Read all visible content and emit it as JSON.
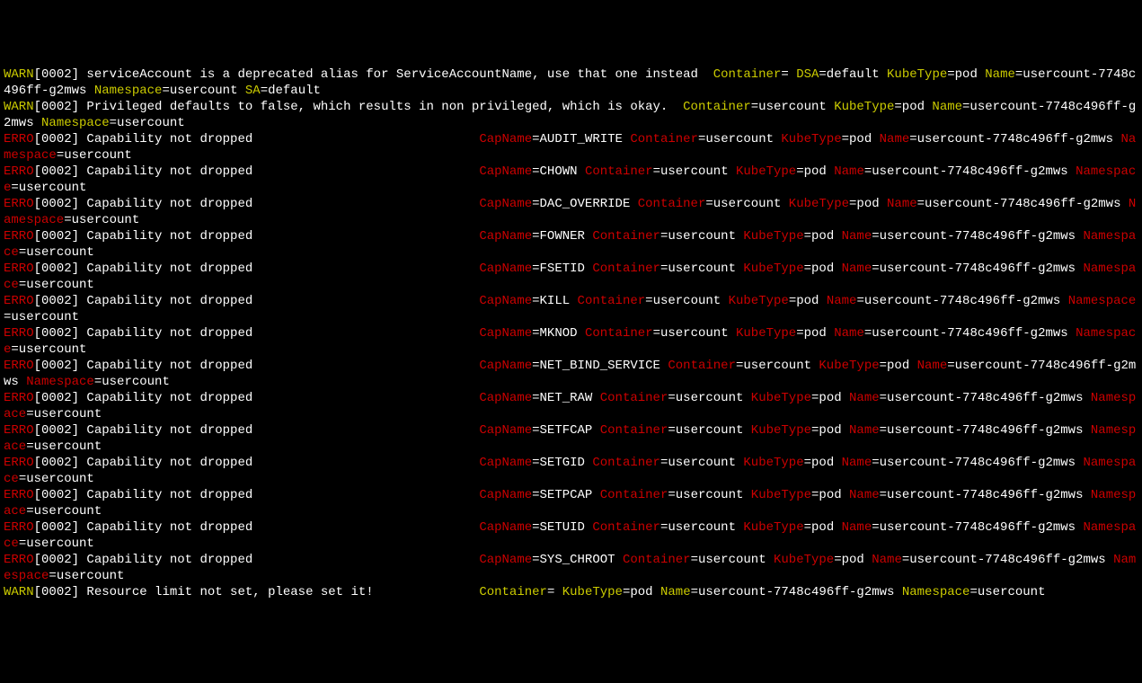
{
  "labels": {
    "WARN": "WARN",
    "ERRO": "ERRO",
    "Container": "Container",
    "DSA": "DSA",
    "KubeType": "KubeType",
    "Name": "Name",
    "Namespace": "Namespace",
    "SA": "SA",
    "CapName": "CapName"
  },
  "lines": [
    {
      "level": "WARN",
      "ts": "[0002]",
      "msg": " serviceAccount is a deprecated alias for ServiceAccountName, use that one instead  ",
      "kv": [
        {
          "k": "Container",
          "v": ""
        },
        {
          "k": "DSA",
          "v": "default"
        },
        {
          "k": "KubeType",
          "v": "pod"
        },
        {
          "k": "Name",
          "v": "usercount-7748c496ff-g2mws"
        },
        {
          "k": "Namespace",
          "v": "usercount"
        },
        {
          "k": "SA",
          "v": "default"
        }
      ]
    },
    {
      "level": "WARN",
      "ts": "[0002]",
      "msg": " Privileged defaults to false, which results in non privileged, which is okay.  ",
      "kv": [
        {
          "k": "Container",
          "v": "usercount"
        },
        {
          "k": "KubeType",
          "v": "pod"
        },
        {
          "k": "Name",
          "v": "usercount-7748c496ff-g2mws"
        },
        {
          "k": "Namespace",
          "v": "usercount"
        }
      ]
    },
    {
      "level": "ERRO",
      "ts": "[0002]",
      "msg": " Capability not dropped",
      "pad": 63,
      "kv": [
        {
          "k": "CapName",
          "v": "AUDIT_WRITE"
        },
        {
          "k": "Container",
          "v": "usercount"
        },
        {
          "k": "KubeType",
          "v": "pod"
        },
        {
          "k": "Name",
          "v": "usercount-7748c496ff-g2mws"
        },
        {
          "k": "Namespace",
          "v": "usercount"
        }
      ]
    },
    {
      "level": "ERRO",
      "ts": "[0002]",
      "msg": " Capability not dropped",
      "pad": 63,
      "kv": [
        {
          "k": "CapName",
          "v": "CHOWN"
        },
        {
          "k": "Container",
          "v": "usercount"
        },
        {
          "k": "KubeType",
          "v": "pod"
        },
        {
          "k": "Name",
          "v": "usercount-7748c496ff-g2mws"
        },
        {
          "k": "Namespace",
          "v": "usercount"
        }
      ]
    },
    {
      "level": "ERRO",
      "ts": "[0002]",
      "msg": " Capability not dropped",
      "pad": 63,
      "kv": [
        {
          "k": "CapName",
          "v": "DAC_OVERRIDE"
        },
        {
          "k": "Container",
          "v": "usercount"
        },
        {
          "k": "KubeType",
          "v": "pod"
        },
        {
          "k": "Name",
          "v": "usercount-7748c496ff-g2mws"
        },
        {
          "k": "Namespace",
          "v": "usercount"
        }
      ]
    },
    {
      "level": "ERRO",
      "ts": "[0002]",
      "msg": " Capability not dropped",
      "pad": 63,
      "kv": [
        {
          "k": "CapName",
          "v": "FOWNER"
        },
        {
          "k": "Container",
          "v": "usercount"
        },
        {
          "k": "KubeType",
          "v": "pod"
        },
        {
          "k": "Name",
          "v": "usercount-7748c496ff-g2mws"
        },
        {
          "k": "Namespace",
          "v": "usercount"
        }
      ]
    },
    {
      "level": "ERRO",
      "ts": "[0002]",
      "msg": " Capability not dropped",
      "pad": 63,
      "kv": [
        {
          "k": "CapName",
          "v": "FSETID"
        },
        {
          "k": "Container",
          "v": "usercount"
        },
        {
          "k": "KubeType",
          "v": "pod"
        },
        {
          "k": "Name",
          "v": "usercount-7748c496ff-g2mws"
        },
        {
          "k": "Namespace",
          "v": "usercount"
        }
      ]
    },
    {
      "level": "ERRO",
      "ts": "[0002]",
      "msg": " Capability not dropped",
      "pad": 63,
      "kv": [
        {
          "k": "CapName",
          "v": "KILL"
        },
        {
          "k": "Container",
          "v": "usercount"
        },
        {
          "k": "KubeType",
          "v": "pod"
        },
        {
          "k": "Name",
          "v": "usercount-7748c496ff-g2mws"
        },
        {
          "k": "Namespace",
          "v": "usercount"
        }
      ]
    },
    {
      "level": "ERRO",
      "ts": "[0002]",
      "msg": " Capability not dropped",
      "pad": 63,
      "kv": [
        {
          "k": "CapName",
          "v": "MKNOD"
        },
        {
          "k": "Container",
          "v": "usercount"
        },
        {
          "k": "KubeType",
          "v": "pod"
        },
        {
          "k": "Name",
          "v": "usercount-7748c496ff-g2mws"
        },
        {
          "k": "Namespace",
          "v": "usercount"
        }
      ]
    },
    {
      "level": "ERRO",
      "ts": "[0002]",
      "msg": " Capability not dropped",
      "pad": 63,
      "kv": [
        {
          "k": "CapName",
          "v": "NET_BIND_SERVICE"
        },
        {
          "k": "Container",
          "v": "usercount"
        },
        {
          "k": "KubeType",
          "v": "pod"
        },
        {
          "k": "Name",
          "v": "usercount-7748c496ff-g2mws"
        },
        {
          "k": "Namespace",
          "v": "usercount"
        }
      ]
    },
    {
      "level": "ERRO",
      "ts": "[0002]",
      "msg": " Capability not dropped",
      "pad": 63,
      "kv": [
        {
          "k": "CapName",
          "v": "NET_RAW"
        },
        {
          "k": "Container",
          "v": "usercount"
        },
        {
          "k": "KubeType",
          "v": "pod"
        },
        {
          "k": "Name",
          "v": "usercount-7748c496ff-g2mws"
        },
        {
          "k": "Namespace",
          "v": "usercount"
        }
      ]
    },
    {
      "level": "ERRO",
      "ts": "[0002]",
      "msg": " Capability not dropped",
      "pad": 63,
      "kv": [
        {
          "k": "CapName",
          "v": "SETFCAP"
        },
        {
          "k": "Container",
          "v": "usercount"
        },
        {
          "k": "KubeType",
          "v": "pod"
        },
        {
          "k": "Name",
          "v": "usercount-7748c496ff-g2mws"
        },
        {
          "k": "Namespace",
          "v": "usercount"
        }
      ]
    },
    {
      "level": "ERRO",
      "ts": "[0002]",
      "msg": " Capability not dropped",
      "pad": 63,
      "kv": [
        {
          "k": "CapName",
          "v": "SETGID"
        },
        {
          "k": "Container",
          "v": "usercount"
        },
        {
          "k": "KubeType",
          "v": "pod"
        },
        {
          "k": "Name",
          "v": "usercount-7748c496ff-g2mws"
        },
        {
          "k": "Namespace",
          "v": "usercount"
        }
      ]
    },
    {
      "level": "ERRO",
      "ts": "[0002]",
      "msg": " Capability not dropped",
      "pad": 63,
      "kv": [
        {
          "k": "CapName",
          "v": "SETPCAP"
        },
        {
          "k": "Container",
          "v": "usercount"
        },
        {
          "k": "KubeType",
          "v": "pod"
        },
        {
          "k": "Name",
          "v": "usercount-7748c496ff-g2mws"
        },
        {
          "k": "Namespace",
          "v": "usercount"
        }
      ]
    },
    {
      "level": "ERRO",
      "ts": "[0002]",
      "msg": " Capability not dropped",
      "pad": 63,
      "kv": [
        {
          "k": "CapName",
          "v": "SETUID"
        },
        {
          "k": "Container",
          "v": "usercount"
        },
        {
          "k": "KubeType",
          "v": "pod"
        },
        {
          "k": "Name",
          "v": "usercount-7748c496ff-g2mws"
        },
        {
          "k": "Namespace",
          "v": "usercount"
        }
      ]
    },
    {
      "level": "ERRO",
      "ts": "[0002]",
      "msg": " Capability not dropped",
      "pad": 63,
      "kv": [
        {
          "k": "CapName",
          "v": "SYS_CHROOT"
        },
        {
          "k": "Container",
          "v": "usercount"
        },
        {
          "k": "KubeType",
          "v": "pod"
        },
        {
          "k": "Name",
          "v": "usercount-7748c496ff-g2mws"
        },
        {
          "k": "Namespace",
          "v": "usercount"
        }
      ]
    },
    {
      "level": "WARN",
      "ts": "[0002]",
      "msg": " Resource limit not set, please set it!",
      "pad": 63,
      "kv": [
        {
          "k": "Container",
          "v": ""
        },
        {
          "k": "KubeType",
          "v": "pod"
        },
        {
          "k": "Name",
          "v": "usercount-7748c496ff-g2mws"
        },
        {
          "k": "Namespace",
          "v": "usercount"
        }
      ]
    }
  ]
}
